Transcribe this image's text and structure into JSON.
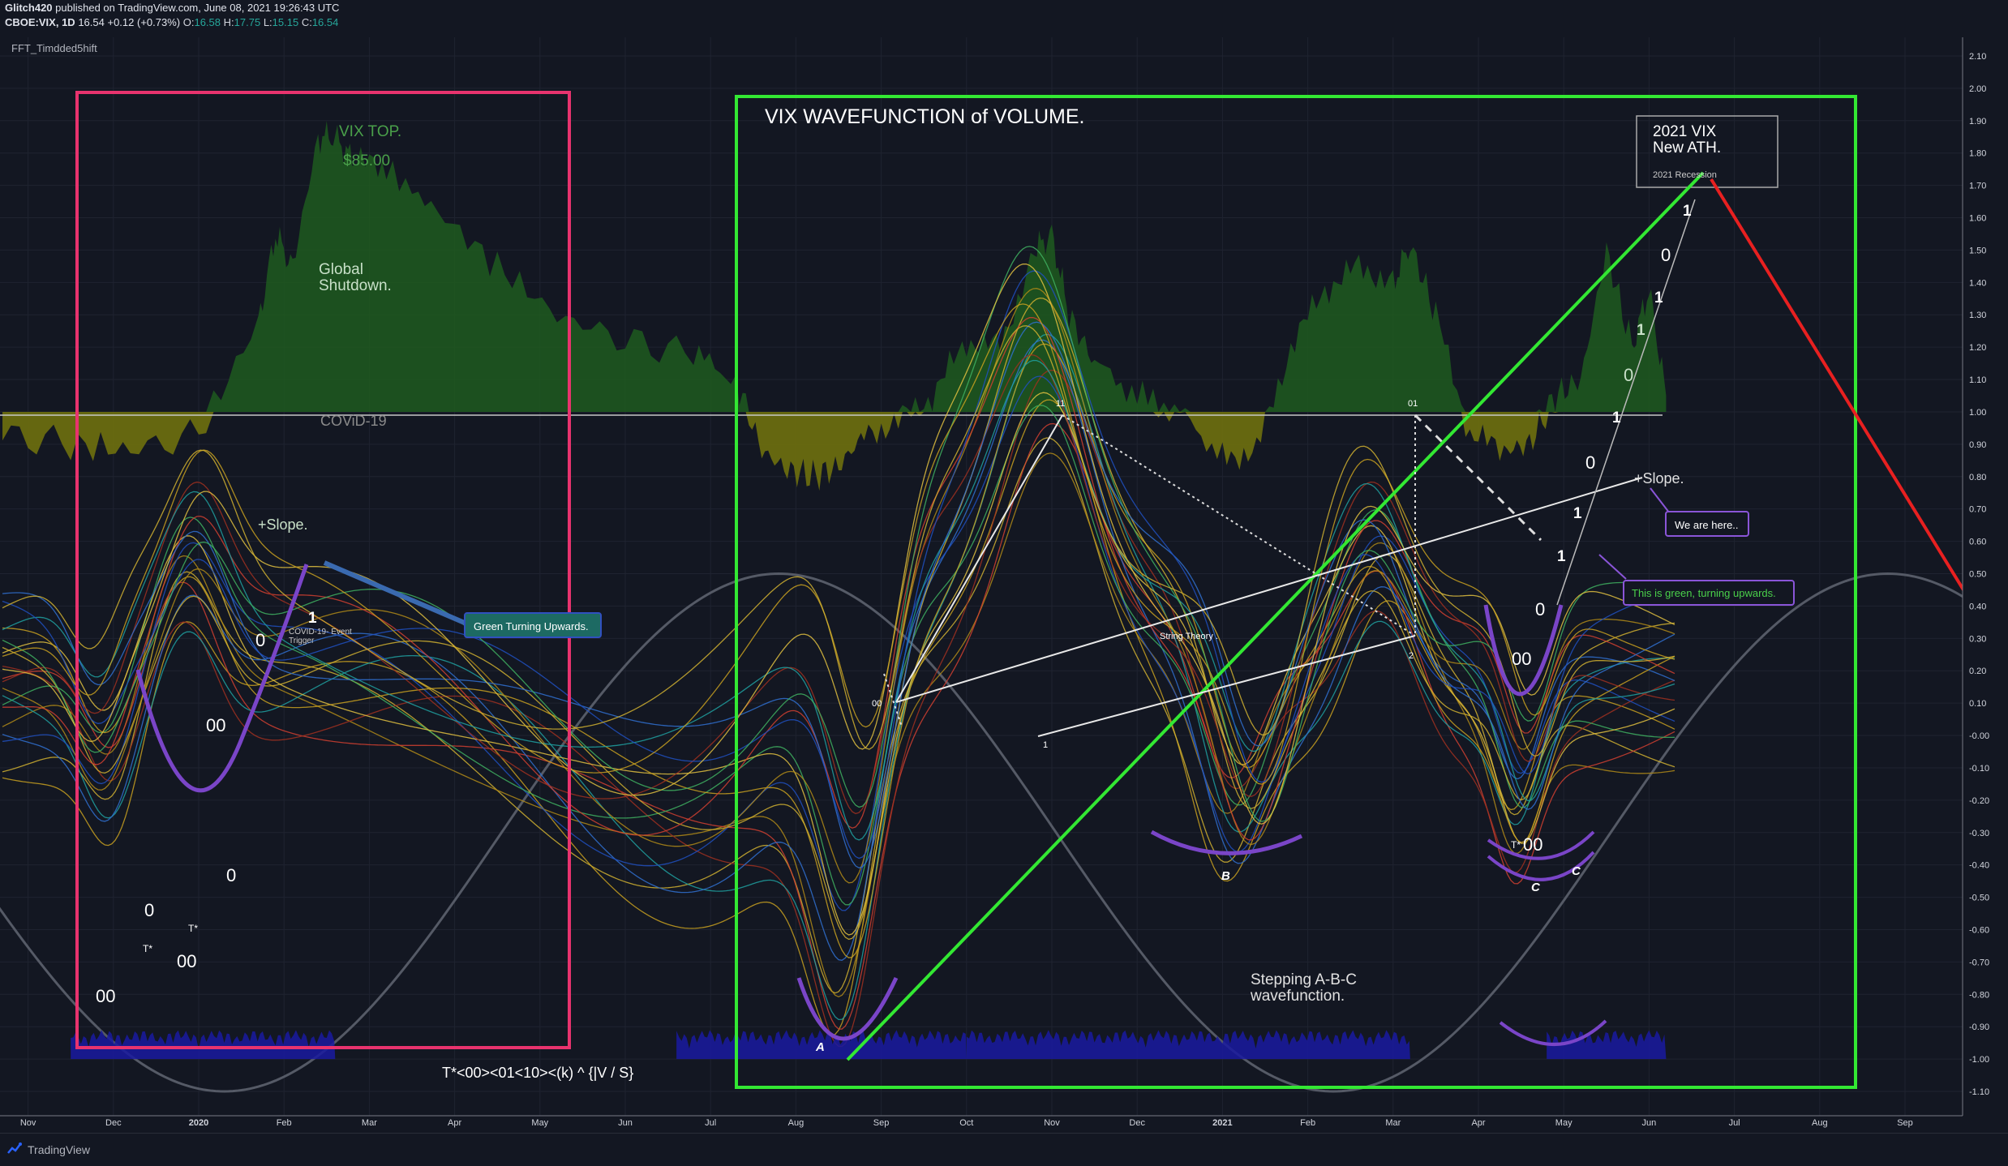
{
  "header": {
    "author": "Glitch420",
    "published": "published on TradingView.com, June 08, 2021 19:26:43 UTC",
    "symbol": "CBOE:VIX, 1D",
    "last": "16.54",
    "change": "+0.12 (+0.73%)",
    "o_label": "O:",
    "o": "16.58",
    "h_label": "H:",
    "h": "17.75",
    "l_label": "L:",
    "l": "15.15",
    "c_label": "C:",
    "c": "16.54"
  },
  "indicator_name": "FFT_Timdded5hift",
  "footer": {
    "brand": "TradingView",
    "logo_icon": "tradingview-logo-icon"
  },
  "colors": {
    "background": "#131722",
    "green_area": "#1e5a1e",
    "olive_area": "#7a7a10",
    "pink_box": "#e8336e",
    "green_box": "#33e833",
    "red_line": "#e82020",
    "purple": "#7a45c8",
    "volume": "#1a1aa0"
  },
  "annotations": {
    "vix_top": "VIX TOP.",
    "vix_top_price": "$85.00",
    "global_shutdown_1": "Global",
    "global_shutdown_2": "Shutdown.",
    "covid": "COViD-19",
    "slope_left": "+Slope.",
    "slope_right": "+Slope.",
    "green_turning": "Green Turning Upwards.",
    "covid_trigger_1": "COVID-19- Event",
    "covid_trigger_2": "Trigger",
    "wave_title": "VIX WAVEFUNCTION of VOLUME.",
    "ath_1": "2021 VIX",
    "ath_2": "New ATH.",
    "ath_3": "2021 Recession",
    "we_are_here": "We are here..",
    "this_is_green": "This is green, turning upwards.",
    "string_theory": "String Theory .",
    "stepping_1": "Stepping A-B-C",
    "stepping_2": "wavefunction.",
    "formula": "T*<00><01<10><(k) ^ {|V / S}",
    "label_a": "A",
    "label_b": "B",
    "label_c1": "C",
    "label_c2": "C",
    "label_11": "11",
    "label_01": "01",
    "label_00_small": "00",
    "label_1_small": "1",
    "label_2_small": "2",
    "left_digits": [
      "1",
      "0",
      "00",
      "0",
      "0",
      "T*",
      "T*",
      "00",
      "00"
    ],
    "right_digits": [
      "1",
      "0",
      "1",
      "1",
      "0",
      "1",
      "0",
      "1",
      "1",
      "0",
      "00"
    ],
    "t_star_right": "T*",
    "zero_zero_right": "00"
  },
  "chart_data": {
    "type": "area",
    "title": "",
    "x_ticks": [
      "Nov",
      "Dec",
      "2020",
      "Feb",
      "Mar",
      "Apr",
      "May",
      "Jun",
      "Jul",
      "Aug",
      "Sep",
      "Oct",
      "Nov",
      "Dec",
      "2021",
      "Feb",
      "Mar",
      "Apr",
      "May",
      "Jun",
      "Jul",
      "Aug",
      "Sep"
    ],
    "y_ticks": [
      "2.10",
      "2.00",
      "1.90",
      "1.80",
      "1.70",
      "1.60",
      "1.50",
      "1.40",
      "1.30",
      "1.20",
      "1.10",
      "1.00",
      "0.90",
      "0.80",
      "0.70",
      "0.60",
      "0.50",
      "0.40",
      "0.30",
      "0.20",
      "0.10",
      "-0.00",
      "-0.10",
      "-0.20",
      "-0.30",
      "-0.40",
      "-0.50",
      "-0.60",
      "-0.70",
      "-0.80",
      "-0.90",
      "-1.00",
      "-1.10"
    ],
    "ylim": [
      -1.12,
      2.12
    ],
    "baseline": 1.0,
    "x_months": [
      -2,
      -1,
      0,
      1,
      2,
      3,
      4,
      5,
      6,
      7,
      8,
      9,
      10,
      11,
      12,
      13,
      14,
      15,
      16,
      17,
      18,
      19,
      20
    ],
    "fft_series": {
      "x": [
        -2.3,
        -1.5,
        -0.8,
        0.0,
        0.7,
        0.9,
        1.1,
        1.4,
        1.6,
        1.8,
        2.2,
        2.8,
        3.5,
        4.2,
        5.0,
        5.8,
        6.3,
        6.6,
        6.9,
        7.2,
        7.5,
        7.8,
        8.2,
        8.6,
        9.0,
        9.4,
        9.8,
        10.0,
        10.2,
        10.5,
        11.0,
        11.5,
        12.0,
        12.4,
        12.8,
        13.2,
        13.6,
        14.0,
        14.2,
        14.5,
        14.9,
        15.3,
        15.6,
        15.9,
        16.2,
        16.5,
        16.8,
        17.0,
        17.2
      ],
      "y": [
        0.93,
        0.9,
        0.88,
        0.93,
        1.28,
        1.55,
        1.45,
        1.85,
        1.85,
        1.78,
        1.75,
        1.62,
        1.45,
        1.3,
        1.22,
        1.18,
        1.1,
        0.88,
        0.82,
        0.8,
        0.83,
        0.93,
        0.97,
        1.05,
        1.22,
        1.2,
        1.5,
        1.55,
        1.3,
        1.15,
        1.05,
        1.0,
        0.86,
        0.88,
        1.2,
        1.38,
        1.45,
        1.4,
        1.52,
        1.3,
        0.93,
        0.88,
        0.9,
        1.05,
        1.1,
        1.5,
        1.2,
        1.38,
        1.05
      ]
    },
    "sine_series": {
      "amplitude": 0.8,
      "center": -0.3,
      "period_months": 13,
      "phase_month": 6.8
    }
  }
}
